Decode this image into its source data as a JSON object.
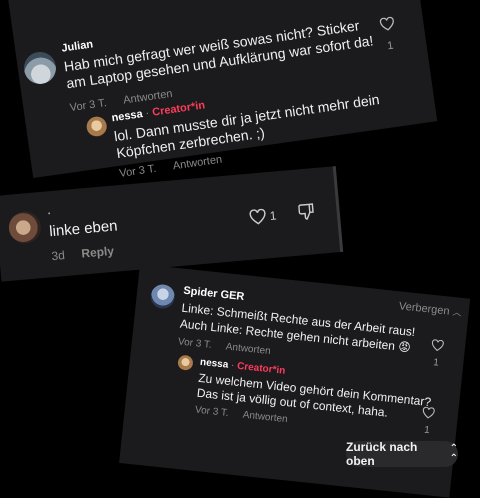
{
  "card1": {
    "top_count": "6",
    "comment": {
      "author": "Julian",
      "line1": "Hab mich gefragt wer weiß sowas nicht? Sticker",
      "line2": "am Laptop gesehen und Aufklärung war sofort da!",
      "time": "Vor 3 T.",
      "reply": "Antworten",
      "likes": "1"
    },
    "reply": {
      "author": "nessa",
      "separator": " · ",
      "badge": "Creator*in",
      "line1": "lol. Dann musste dir ja jetzt nicht mehr dein",
      "line2": "Köpfchen zerbrechen. ;)",
      "time": "Vor 3 T.",
      "reply": "Antworten"
    }
  },
  "card2": {
    "author": ".",
    "text": "linke eben",
    "time": "3d",
    "reply": "Reply",
    "likes": "1"
  },
  "card3": {
    "hide_label": "Verbergen",
    "comment": {
      "author": "Spider GER",
      "line1": "Linke: Schmeißt Rechte aus der Arbeit raus!",
      "line2": "Auch Linke: Rechte gehen nicht arbeiten",
      "emoji": "😡",
      "time": "Vor 3 T.",
      "reply": "Antworten",
      "likes": "1"
    },
    "reply": {
      "author": "nessa",
      "separator": " · ",
      "badge": "Creator*in",
      "line1": "Zu welchem Video gehört dein Kommentar?",
      "line2": "Das ist ja völlig out of context, haha.",
      "time": "Vor 3 T.",
      "reply": "Antworten",
      "likes": "1"
    }
  },
  "back_to_top": "Zurück nach oben"
}
